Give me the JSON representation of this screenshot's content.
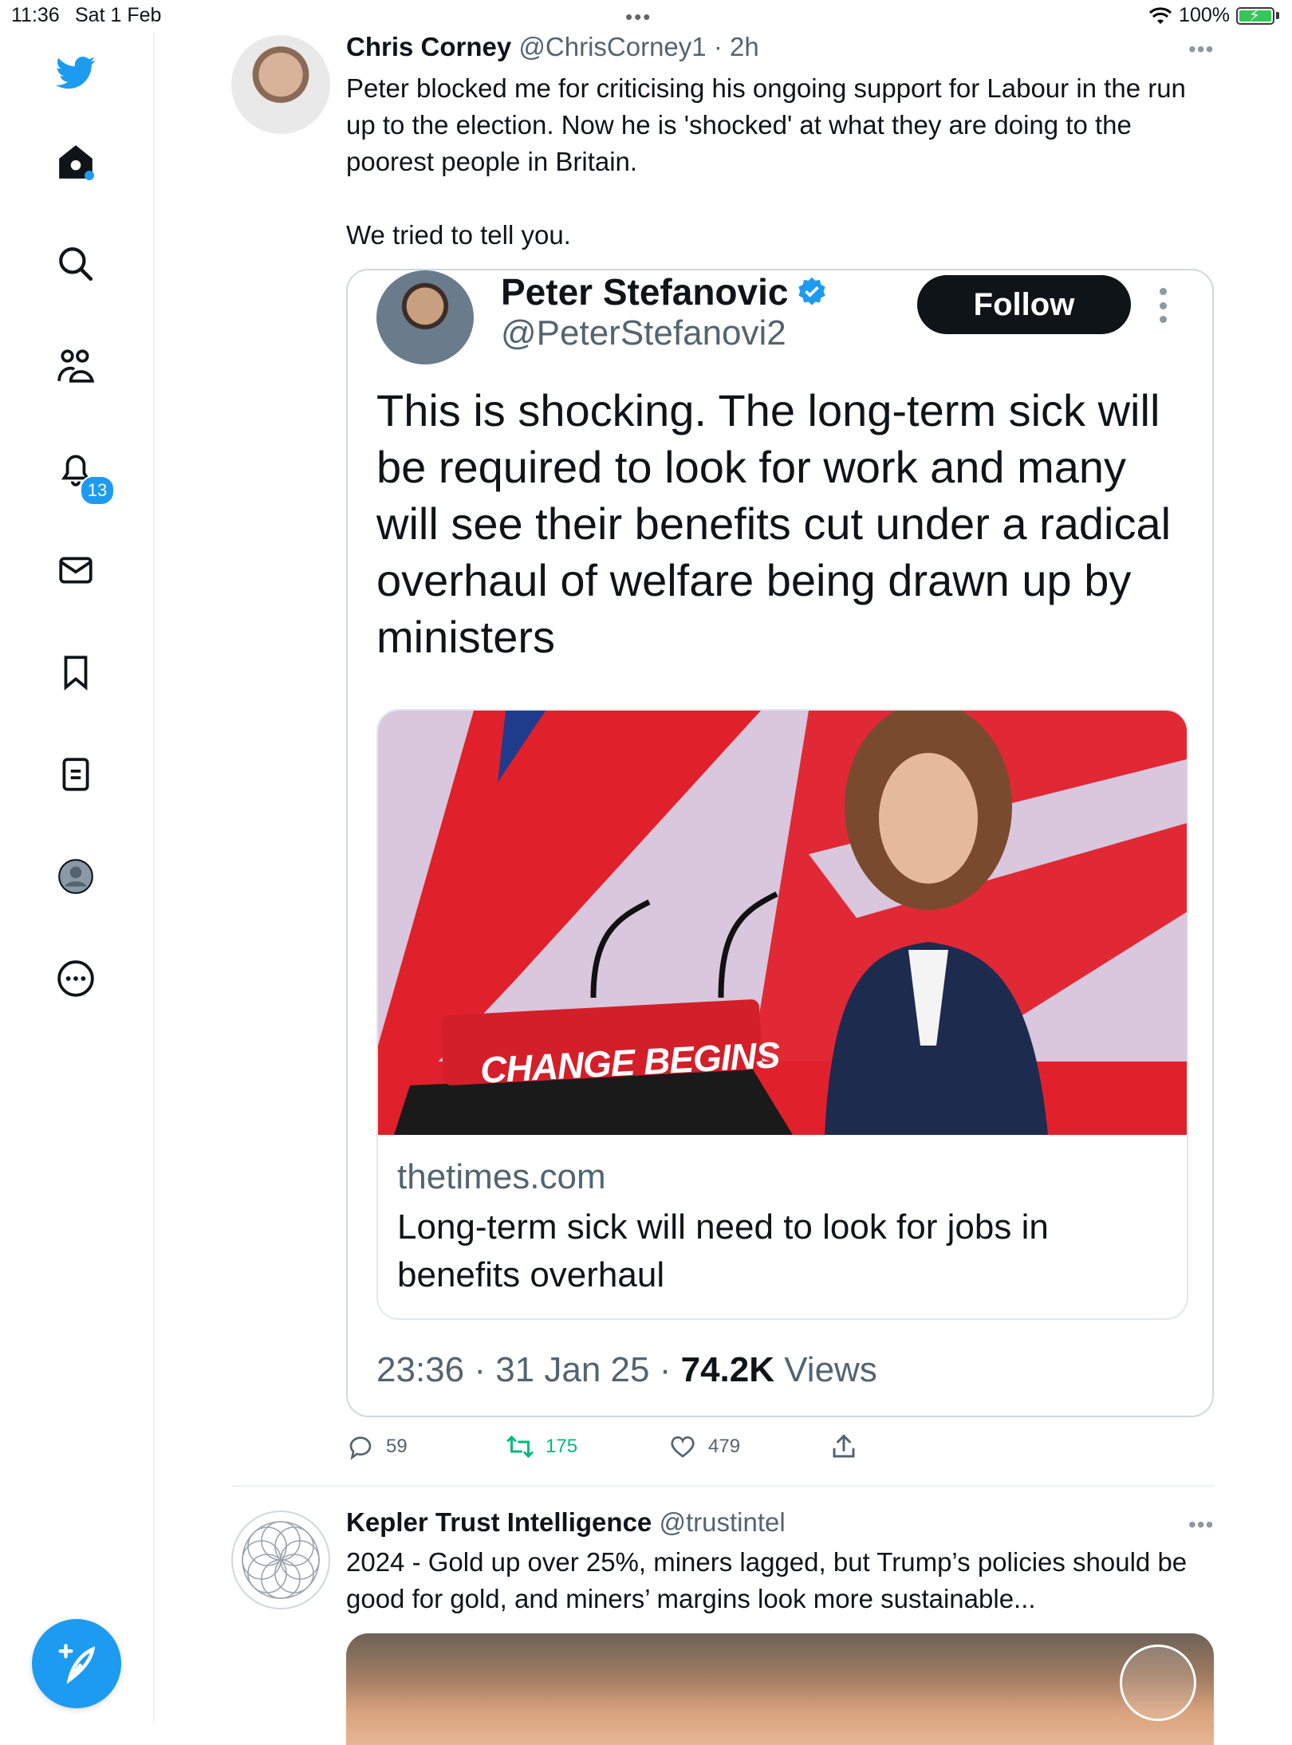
{
  "status_bar": {
    "time": "11:36",
    "date": "Sat 1 Feb",
    "battery": "100%"
  },
  "sidebar": {
    "items": [
      {
        "icon": "twitter-bird-icon"
      },
      {
        "icon": "home-icon"
      },
      {
        "icon": "search-icon"
      },
      {
        "icon": "communities-icon"
      },
      {
        "icon": "notifications-icon",
        "badge": "13"
      },
      {
        "icon": "messages-icon"
      },
      {
        "icon": "bookmarks-icon"
      },
      {
        "icon": "lists-icon"
      },
      {
        "icon": "profile-icon"
      },
      {
        "icon": "more-icon"
      }
    ],
    "compose_icon": "compose-icon"
  },
  "tweet1": {
    "name": "Chris Corney",
    "handle": "@ChrisCorney1",
    "time": "· 2h",
    "text_p1": "Peter blocked me for criticising his ongoing support for Labour in the run up to the election. Now he is 'shocked' at what they are doing to the poorest people in Britain.",
    "text_p2": "We tried to tell you.",
    "quote": {
      "name": "Peter Stefanovic",
      "handle": "@PeterStefanovi2",
      "follow_label": "Follow",
      "text": "This is shocking. The long-term sick will be required to look for work and many will see their benefits cut under a radical overhaul of welfare being drawn up by ministers",
      "card": {
        "sign_text": "CHANGE BEGINS",
        "domain": "thetimes.com",
        "title": "Long-term sick will need to look for jobs in benefits overhaul"
      },
      "meta_time": "23:36 · 31 Jan 25 ·",
      "views_count": "74.2K",
      "views_label": "Views"
    },
    "actions": {
      "replies": "59",
      "retweets": "175",
      "likes": "479"
    }
  },
  "tweet2": {
    "name": "Kepler Trust Intelligence",
    "handle": "@trustintel",
    "text": "2024 - Gold up over 25%, miners lagged, but Trump’s policies should be good for gold, and miners’ margins look more sustainable..."
  },
  "colors": {
    "accent": "#1d9bf0",
    "text": "#0f1419",
    "secondary": "#536471",
    "retweet": "#00ba7c",
    "border": "#cfd9de"
  }
}
